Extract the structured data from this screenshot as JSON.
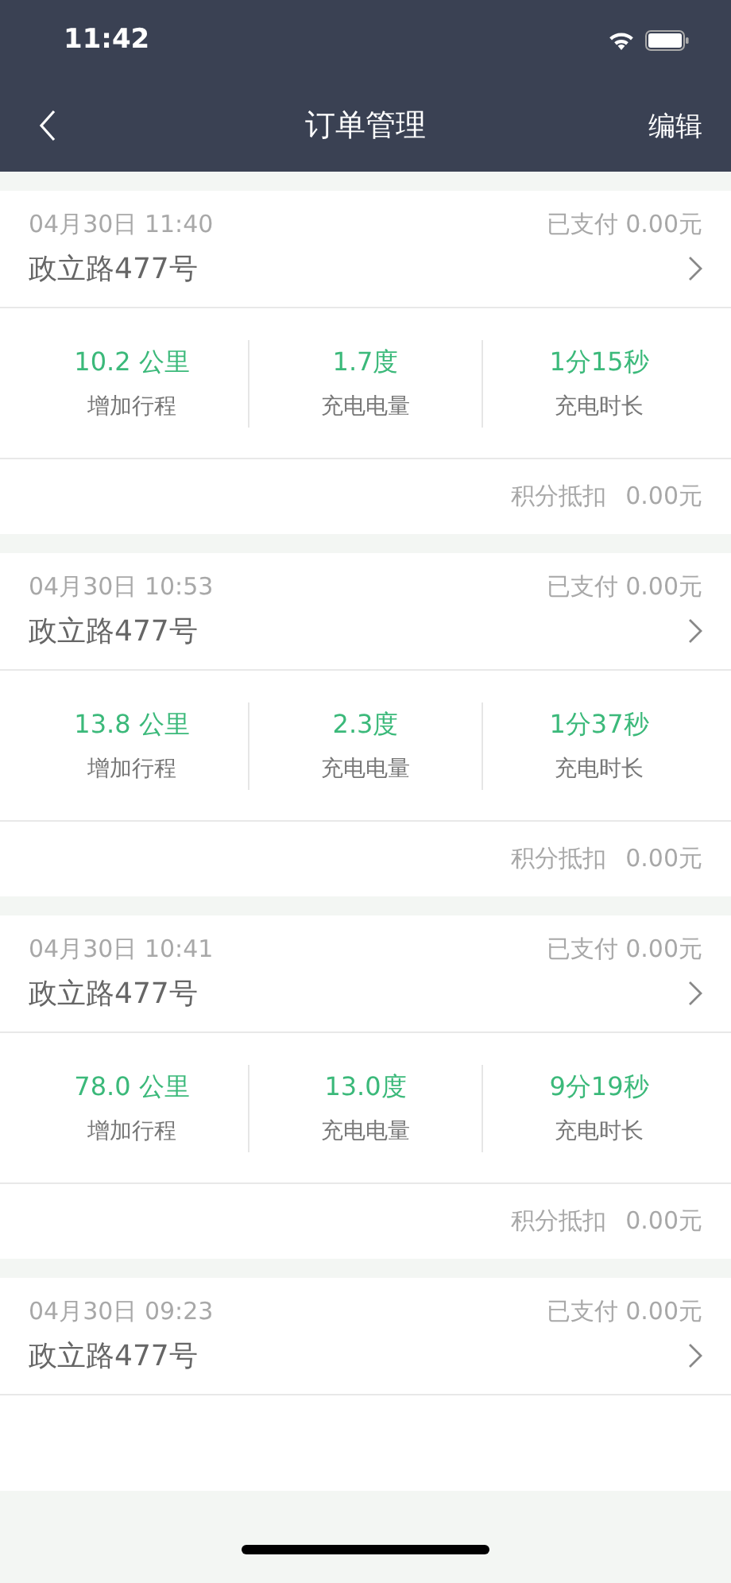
{
  "status_bar": {
    "time": "11:42"
  },
  "nav": {
    "title": "订单管理",
    "action": "编辑"
  },
  "orders": [
    {
      "datetime": "04月30日 11:40",
      "paid": "已支付 0.00元",
      "address": "政立路477号",
      "stats": [
        {
          "value": "10.2 公里",
          "label": "增加行程"
        },
        {
          "value": "1.7度",
          "label": "充电电量"
        },
        {
          "value": "1分15秒",
          "label": "充电时长"
        }
      ],
      "points_label": "积分抵扣",
      "points_value": "0.00元"
    },
    {
      "datetime": "04月30日 10:53",
      "paid": "已支付 0.00元",
      "address": "政立路477号",
      "stats": [
        {
          "value": "13.8 公里",
          "label": "增加行程"
        },
        {
          "value": "2.3度",
          "label": "充电电量"
        },
        {
          "value": "1分37秒",
          "label": "充电时长"
        }
      ],
      "points_label": "积分抵扣",
      "points_value": "0.00元"
    },
    {
      "datetime": "04月30日 10:41",
      "paid": "已支付 0.00元",
      "address": "政立路477号",
      "stats": [
        {
          "value": "78.0 公里",
          "label": "增加行程"
        },
        {
          "value": "13.0度",
          "label": "充电电量"
        },
        {
          "value": "9分19秒",
          "label": "充电时长"
        }
      ],
      "points_label": "积分抵扣",
      "points_value": "0.00元"
    },
    {
      "datetime": "04月30日 09:23",
      "paid": "已支付 0.00元",
      "address": "政立路477号"
    }
  ]
}
